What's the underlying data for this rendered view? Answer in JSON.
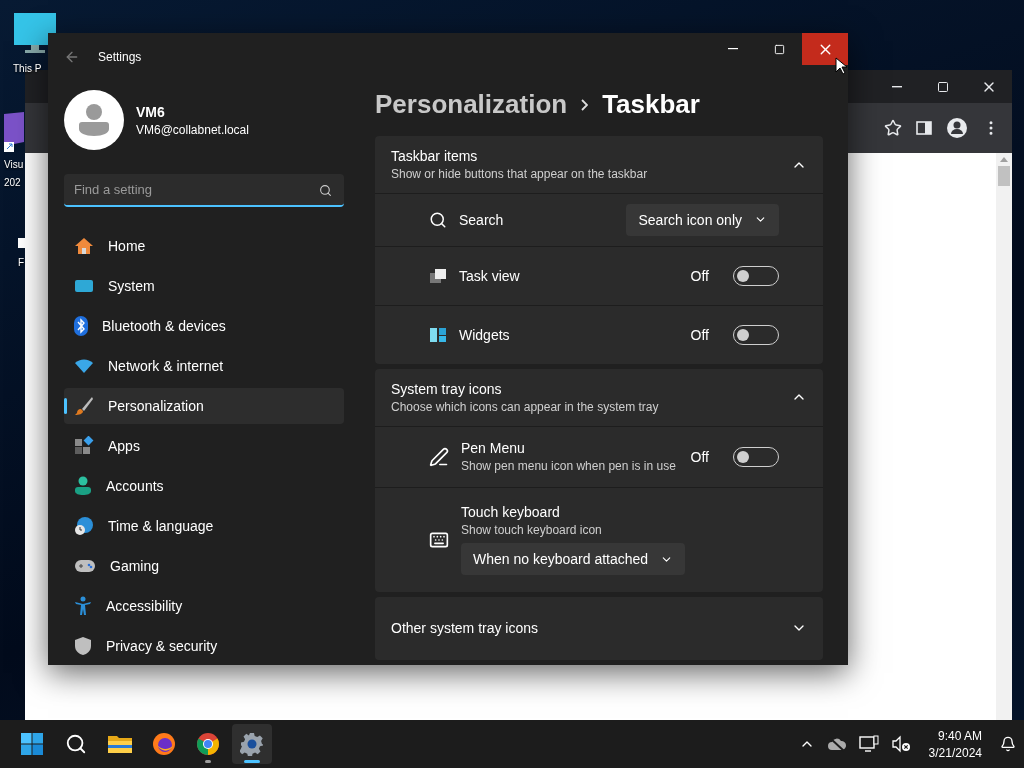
{
  "desktop": {
    "icons": [
      {
        "lines": [
          "This P"
        ]
      },
      {
        "lines": [
          "Visu",
          "202"
        ]
      },
      {
        "lines": [
          "F"
        ]
      }
    ]
  },
  "settings": {
    "title": "Settings",
    "close_hovered": true,
    "user": {
      "name": "VM6",
      "email": "VM6@collabnet.local"
    },
    "search": {
      "placeholder": "Find a setting"
    },
    "nav": [
      {
        "label": "Home",
        "selected": false
      },
      {
        "label": "System",
        "selected": false
      },
      {
        "label": "Bluetooth & devices",
        "selected": false
      },
      {
        "label": "Network & internet",
        "selected": false
      },
      {
        "label": "Personalization",
        "selected": true
      },
      {
        "label": "Apps",
        "selected": false
      },
      {
        "label": "Accounts",
        "selected": false
      },
      {
        "label": "Time & language",
        "selected": false
      },
      {
        "label": "Gaming",
        "selected": false
      },
      {
        "label": "Accessibility",
        "selected": false
      },
      {
        "label": "Privacy & security",
        "selected": false
      }
    ],
    "breadcrumb": [
      "Personalization",
      "Taskbar"
    ],
    "sections": [
      {
        "title": "Taskbar items",
        "subtitle": "Show or hide buttons that appear on the taskbar",
        "expanded": true,
        "rows": [
          {
            "kind": "dropdown",
            "label": "Search",
            "value": "Search icon only"
          },
          {
            "kind": "toggle",
            "label": "Task view",
            "on": false,
            "state_label": "Off"
          },
          {
            "kind": "toggle",
            "label": "Widgets",
            "on": false,
            "state_label": "Off"
          }
        ]
      },
      {
        "title": "System tray icons",
        "subtitle": "Choose which icons can appear in the system tray",
        "expanded": true,
        "rows": [
          {
            "kind": "toggle",
            "label": "Pen Menu",
            "description": "Show pen menu icon when pen is in use",
            "on": false,
            "state_label": "Off"
          },
          {
            "kind": "dropdown-below",
            "label": "Touch keyboard",
            "description": "Show touch keyboard icon",
            "value": "When no keyboard attached"
          }
        ]
      },
      {
        "title": "Other system tray icons",
        "expanded": false
      }
    ]
  },
  "taskbar": {
    "apps": [
      {
        "running": false,
        "selected": false
      },
      {
        "running": false,
        "selected": false
      },
      {
        "running": false,
        "selected": false
      },
      {
        "running": false,
        "selected": false
      },
      {
        "running": true,
        "selected": false
      },
      {
        "running": true,
        "selected": true
      }
    ],
    "clock": {
      "time": "9:40 AM",
      "date": "3/21/2024"
    }
  }
}
